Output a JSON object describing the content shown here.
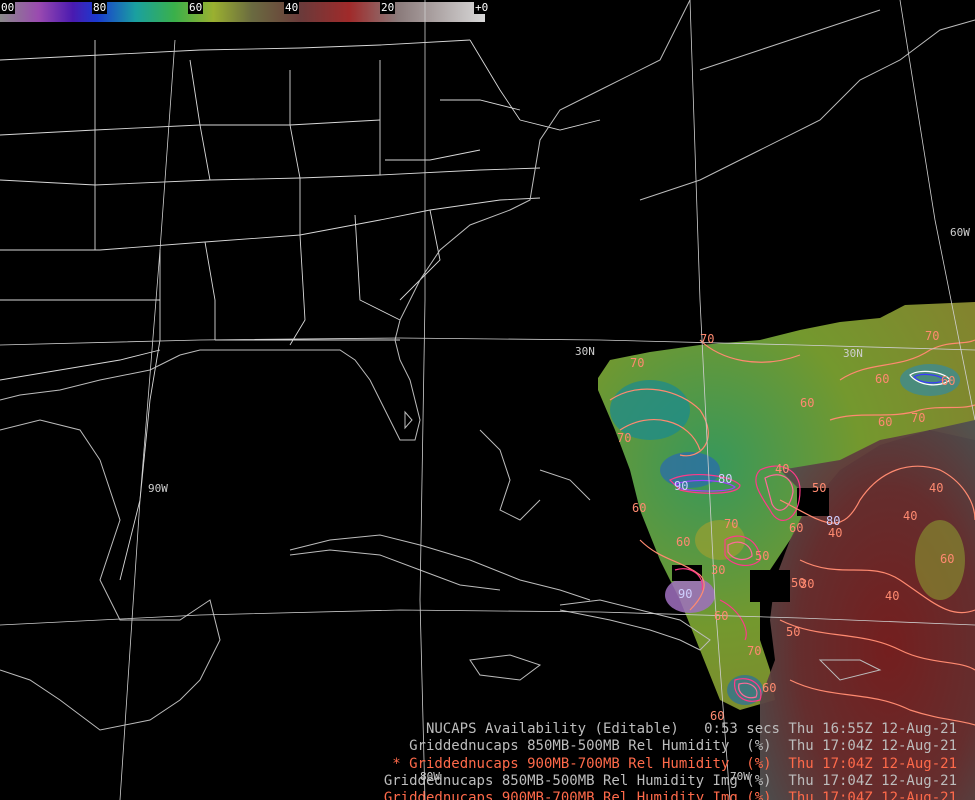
{
  "colorbar": {
    "labels": [
      "00",
      "80",
      "60",
      "40",
      "20",
      "+0"
    ],
    "stops": [
      "#8a8a8a",
      "#7a2aa0",
      "#4a2ad0",
      "#1a8ab0",
      "#3ab04a",
      "#9ab030",
      "#6a6a3a",
      "#7a3030",
      "#a03a3a",
      "#8a8a8a",
      "#d0d0d0"
    ]
  },
  "grid_labels": {
    "lat_30n_a": "30N",
    "lat_30n_b": "30N",
    "lon_90w": "90W",
    "lon_60w": "60W",
    "lon_80w": "80W",
    "lon_70w": "70W"
  },
  "contour_labels": [
    "70",
    "70",
    "60",
    "70",
    "60",
    "60",
    "70",
    "80",
    "60",
    "70",
    "60",
    "90",
    "80",
    "40",
    "50",
    "70",
    "60",
    "50",
    "30",
    "50",
    "60",
    "40",
    "60",
    "30",
    "40",
    "50",
    "40",
    "40",
    "70",
    "60",
    "90",
    "60",
    "60"
  ],
  "legend": {
    "lines": [
      {
        "name": "NUCAPS Availability (Editable)",
        "time": "0:53 secs",
        "date": "Thu 16:55Z 12-Aug-21",
        "color": "grey"
      },
      {
        "name": "Griddednucaps 850MB-500MB Rel Humidity  (%)",
        "time": "",
        "date": "Thu 17:04Z 12-Aug-21",
        "color": "grey"
      },
      {
        "name": "* Griddednucaps 900MB-700MB Rel Humidity  (%)",
        "time": "",
        "date": "Thu 17:04Z 12-Aug-21",
        "color": "red"
      },
      {
        "name": "Griddednucaps 850MB-500MB Rel Humidity Img (%)",
        "time": "",
        "date": "Thu 17:04Z 12-Aug-21",
        "color": "grey"
      },
      {
        "name": "Griddednucaps 900MB-700MB Rel Humidity Img (%)",
        "time": "",
        "date": "Thu 17:04Z 12-Aug-21",
        "color": "red"
      }
    ]
  }
}
